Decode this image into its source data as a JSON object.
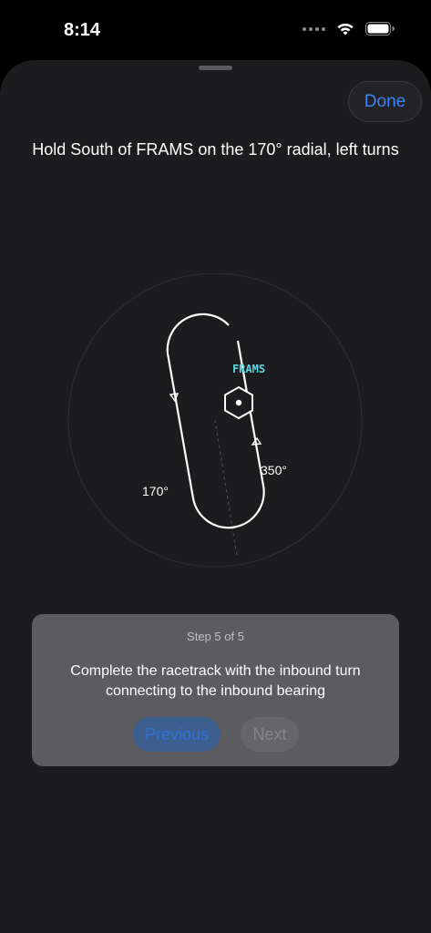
{
  "status_bar": {
    "time": "8:14"
  },
  "sheet": {
    "done_label": "Done",
    "title": "Hold South of FRAMS on the 170° radial, left turns"
  },
  "diagram": {
    "fix_name": "FRAMS",
    "outbound_label": "170°",
    "inbound_label": "350°",
    "colors": {
      "fix_label": "#5ad8e6",
      "track": "#ffffff"
    }
  },
  "step_panel": {
    "step_label": "Step 5 of 5",
    "instruction": "Complete the racetrack with the inbound turn connecting to the inbound bearing",
    "previous_label": "Previous",
    "next_label": "Next"
  },
  "colors": {
    "accent": "#3b82f6",
    "background": "#000000",
    "sheet": "#1c1c1e"
  }
}
